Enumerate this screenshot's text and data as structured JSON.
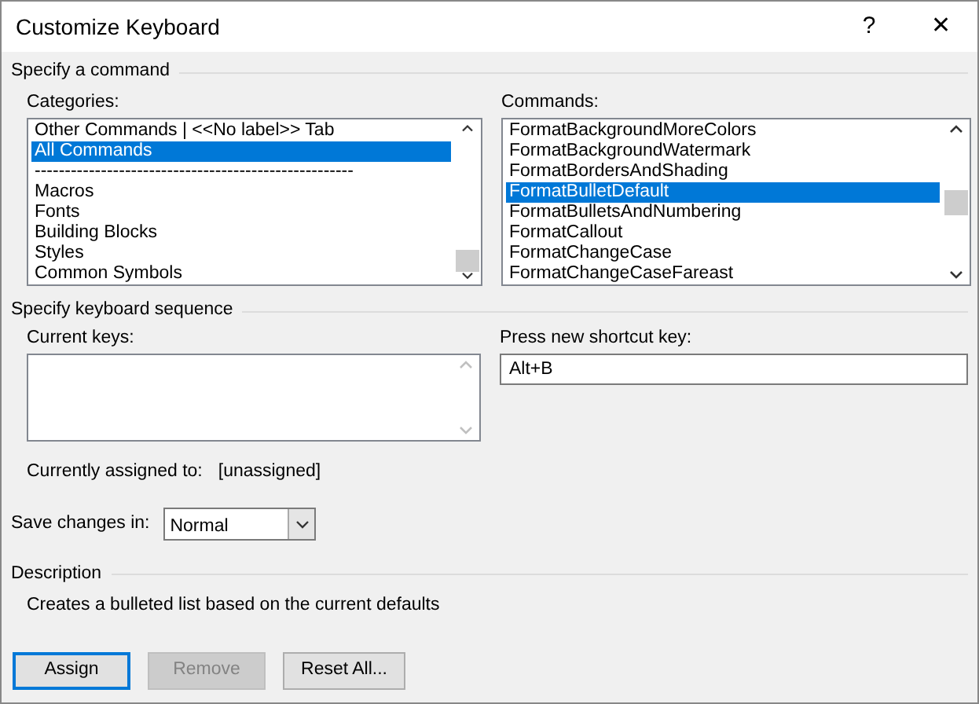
{
  "window": {
    "title": "Customize Keyboard",
    "help": "?",
    "close": "✕"
  },
  "command_section": {
    "heading": "Specify a command",
    "categories": {
      "label": "Categories:",
      "items": [
        {
          "text": "Other Commands | <<No label>> Tab",
          "selected": false
        },
        {
          "text": "All Commands",
          "selected": true
        },
        {
          "text": "-----------------------------------------------------",
          "selected": false
        },
        {
          "text": "Macros",
          "selected": false
        },
        {
          "text": "Fonts",
          "selected": false
        },
        {
          "text": "Building Blocks",
          "selected": false
        },
        {
          "text": "Styles",
          "selected": false
        },
        {
          "text": "Common Symbols",
          "selected": false
        }
      ]
    },
    "commands": {
      "label": "Commands:",
      "items": [
        {
          "text": "FormatBackgroundMoreColors",
          "selected": false
        },
        {
          "text": "FormatBackgroundWatermark",
          "selected": false
        },
        {
          "text": "FormatBordersAndShading",
          "selected": false
        },
        {
          "text": "FormatBulletDefault",
          "selected": true
        },
        {
          "text": "FormatBulletsAndNumbering",
          "selected": false
        },
        {
          "text": "FormatCallout",
          "selected": false
        },
        {
          "text": "FormatChangeCase",
          "selected": false
        },
        {
          "text": "FormatChangeCaseFareast",
          "selected": false
        }
      ]
    }
  },
  "keyboard_section": {
    "heading": "Specify keyboard sequence",
    "current_keys_label": "Current keys:",
    "new_key_label": "Press new shortcut key:",
    "new_key_value": "Alt+B",
    "assigned_label": "Currently assigned to:",
    "assigned_value": "[unassigned]"
  },
  "save_changes": {
    "label": "Save changes in:",
    "value": "Normal"
  },
  "description": {
    "heading": "Description",
    "text": "Creates a bulleted list based on the current defaults"
  },
  "buttons": [
    {
      "label": "Assign",
      "default": true,
      "disabled": false
    },
    {
      "label": "Remove",
      "default": false,
      "disabled": true
    },
    {
      "label": "Reset All...",
      "default": false,
      "disabled": false
    }
  ]
}
